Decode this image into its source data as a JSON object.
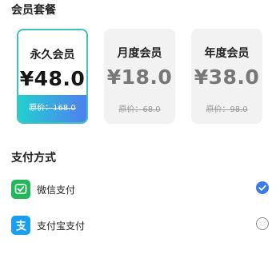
{
  "membership": {
    "title": "会员套餐",
    "plans": [
      {
        "name": "永久会员",
        "price": "¥48.0",
        "original": "原价：168.0",
        "selected": true
      },
      {
        "name": "月度会员",
        "price": "¥18.0",
        "original": "原价：68.0",
        "selected": false
      },
      {
        "name": "年度会员",
        "price": "¥38.0",
        "original": "原价：98.0",
        "selected": false
      }
    ]
  },
  "payment": {
    "title": "支付方式",
    "methods": [
      {
        "label": "微信支付",
        "icon": "wechat-icon",
        "selected": true
      },
      {
        "label": "支付宝支付",
        "icon": "alipay-icon",
        "selected": false
      }
    ]
  },
  "colors": {
    "accent": "#3a7bea",
    "selected_border": "#3ec2c0",
    "gradient_start": "#22cfd0",
    "gradient_end": "#4f7ff0",
    "wechat": "#22b85a",
    "alipay": "#1a9ff0"
  }
}
